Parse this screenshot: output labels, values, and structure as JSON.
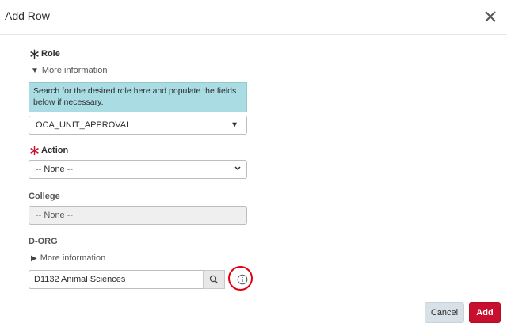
{
  "dialog": {
    "title": "Add Row"
  },
  "role": {
    "label": "Role",
    "more_info": "More information",
    "info_text": "Search for the desired role here and populate the fields below if necessary.",
    "value": "OCA_UNIT_APPROVAL"
  },
  "action": {
    "label": "Action",
    "value": "-- None --"
  },
  "college": {
    "label": "College",
    "value": "-- None --"
  },
  "dorg": {
    "label": "D-ORG",
    "more_info": "More information",
    "value": "D1132 Animal Sciences"
  },
  "buttons": {
    "cancel": "Cancel",
    "add": "Add"
  },
  "colors": {
    "required_star": "#c8102e",
    "primary": "#c8102e",
    "info_bg": "#a9dce3",
    "annotation_circle": "#e3000f"
  },
  "icons": {
    "close": "close-icon",
    "search": "search-icon",
    "info": "info-icon",
    "dropdown": "triangle-down-icon",
    "chevron": "chevron-down-icon"
  }
}
